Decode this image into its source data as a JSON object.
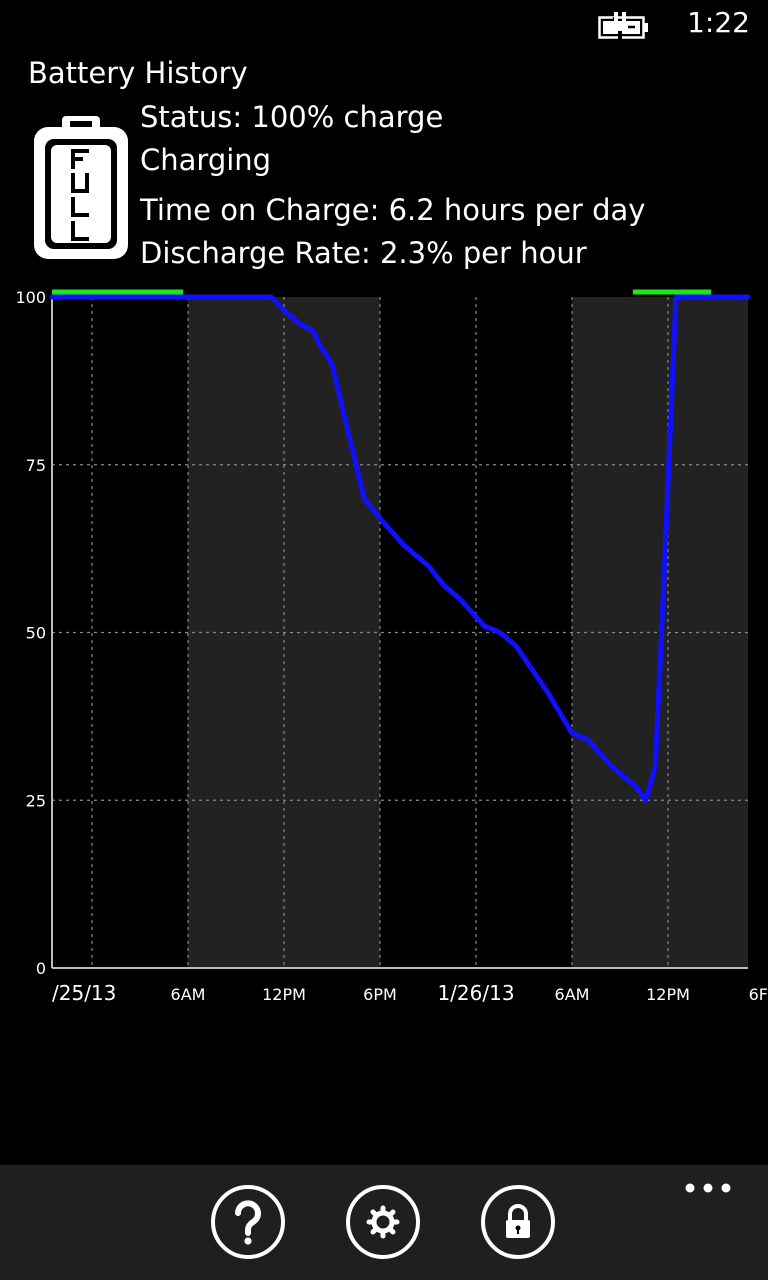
{
  "status_bar": {
    "time": "1:22",
    "battery_icon": "battery-charging-icon"
  },
  "app": {
    "title": "Battery History",
    "status": "Status: 100% charge",
    "state": "Charging",
    "time_on_charge": "Time on Charge: 6.2 hours per day",
    "discharge_rate": "Discharge Rate: 2.3% per hour",
    "battery_graphic_label": "FULL"
  },
  "chart_data": {
    "type": "line",
    "x_tick_labels": [
      "/25/13",
      "6AM",
      "12PM",
      "6PM",
      "1/26/13",
      "6AM",
      "12PM",
      "6F"
    ],
    "y_tick_labels": [
      "100",
      "75",
      "50",
      "25",
      "0"
    ],
    "ylim": [
      0,
      100
    ],
    "x_range_hours": [
      -2.5,
      41
    ],
    "grid": "dotted",
    "night_shading_hours": [
      [
        6,
        18
      ],
      [
        30,
        42
      ]
    ],
    "series": [
      {
        "color": "#1010ff",
        "x_hours": [
          -2.5,
          11.2,
          12,
          13,
          13.8,
          14.2,
          15,
          16,
          17,
          18,
          19.5,
          21,
          22,
          23,
          24.5,
          25.5,
          26.5,
          28.5,
          30,
          31,
          32.5,
          34,
          34.6,
          35.2,
          35.6,
          36.5,
          41
        ],
        "values": [
          100,
          100,
          98,
          96,
          95,
          93,
          90,
          80,
          70,
          67,
          63,
          60,
          57,
          55,
          51,
          50,
          48,
          41,
          35,
          34,
          30,
          27,
          25,
          30,
          50,
          100,
          100
        ]
      }
    ],
    "charging_markers_hours": [
      [
        -2.5,
        5.7
      ],
      [
        33.8,
        38.7
      ]
    ],
    "charging_marker_color": "#1ee61e"
  },
  "app_bar": {
    "help_icon": "help-icon",
    "settings_icon": "settings-gear-icon",
    "lock_icon": "lock-icon",
    "more_icon": "more-ellipsis-icon"
  }
}
